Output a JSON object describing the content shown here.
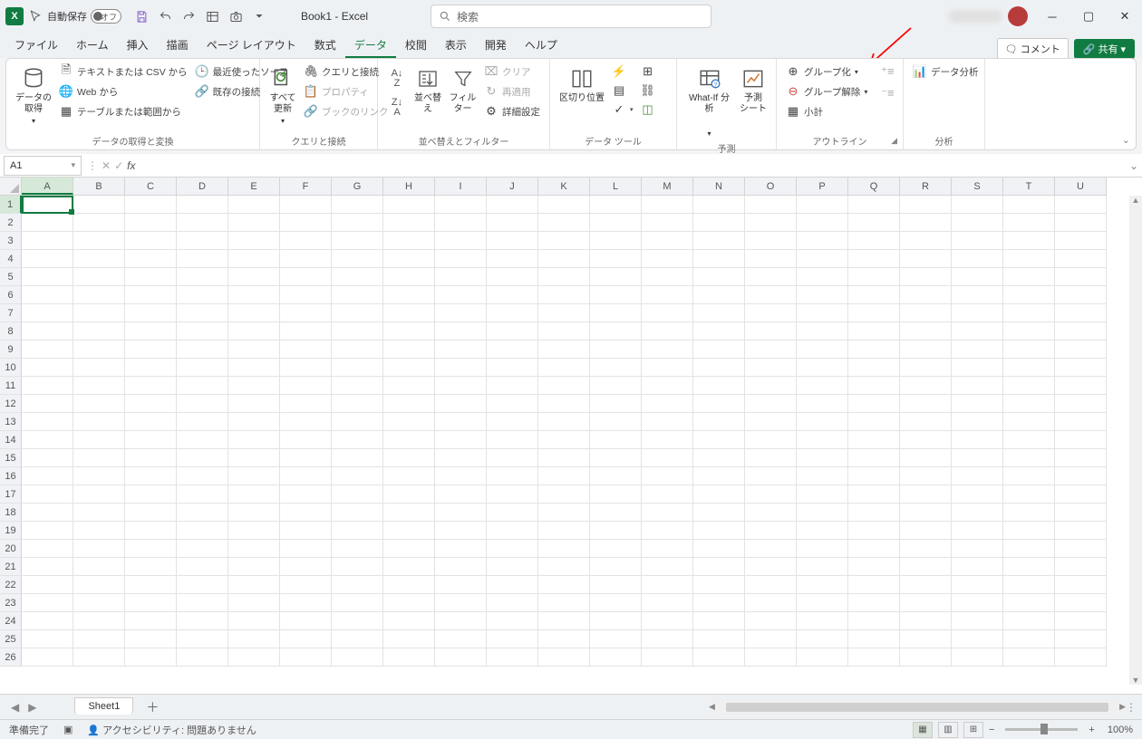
{
  "titlebar": {
    "autosave_label": "自動保存",
    "autosave_state": "オフ",
    "doc_title": "Book1  -  Excel",
    "search_placeholder": "検索"
  },
  "tabs": {
    "items": [
      "ファイル",
      "ホーム",
      "挿入",
      "描画",
      "ページ レイアウト",
      "数式",
      "データ",
      "校閲",
      "表示",
      "開発",
      "ヘルプ"
    ],
    "active": "データ",
    "comment_btn": "コメント",
    "share_btn": "共有"
  },
  "ribbon": {
    "g1": {
      "big": "データの\n取得",
      "items": [
        "テキストまたは CSV から",
        "Web から",
        "テーブルまたは範囲から",
        "最近使ったソース",
        "既存の接続"
      ],
      "label": "データの取得と変換"
    },
    "g2": {
      "big": "すべて\n更新",
      "items": [
        "クエリと接続",
        "プロパティ",
        "ブックのリンク"
      ],
      "label": "クエリと接続"
    },
    "g3": {
      "sort": "並べ替え",
      "filter": "フィルター",
      "clear": "クリア",
      "reapply": "再適用",
      "advanced": "詳細設定",
      "label": "並べ替えとフィルター"
    },
    "g4": {
      "text_to_cols": "区切り位置",
      "label": "データ ツール"
    },
    "g5": {
      "whatif": "What-If 分析",
      "forecast": "予測\nシート",
      "label": "予測"
    },
    "g6": {
      "group": "グループ化",
      "ungroup": "グループ解除",
      "subtotal": "小計",
      "label": "アウトライン"
    },
    "g7": {
      "data_analysis": "データ分析",
      "label": "分析"
    }
  },
  "formula": {
    "name_box": "A1"
  },
  "columns": [
    "A",
    "B",
    "C",
    "D",
    "E",
    "F",
    "G",
    "H",
    "I",
    "J",
    "K",
    "L",
    "M",
    "N",
    "O",
    "P",
    "Q",
    "R",
    "S",
    "T",
    "U"
  ],
  "rows_count": 26,
  "sheet": {
    "name": "Sheet1"
  },
  "status": {
    "ready": "準備完了",
    "accessibility": "アクセシビリティ: 問題ありません",
    "zoom": "100%"
  }
}
